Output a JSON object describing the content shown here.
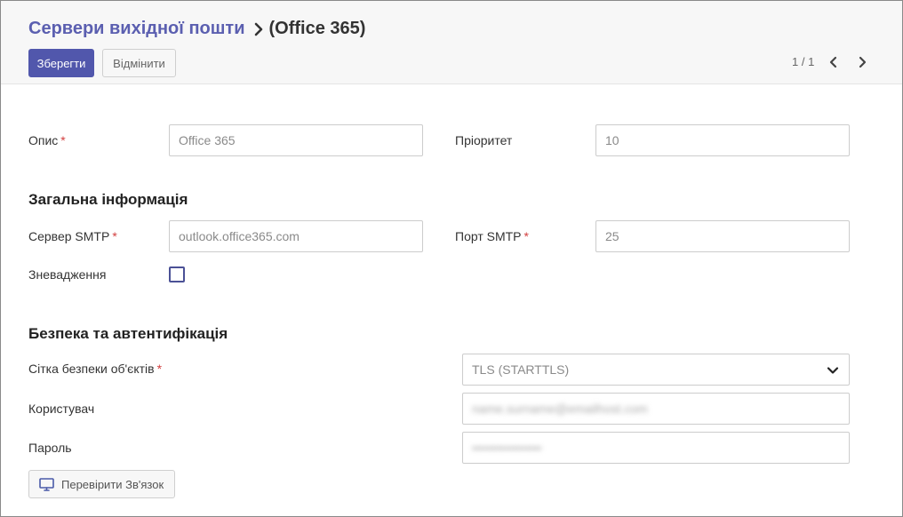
{
  "breadcrumb": {
    "parent": "Сервери вихідної пошти",
    "current": "(Office 365)"
  },
  "toolbar": {
    "save_label": "Зберегти",
    "discard_label": "Відмінити"
  },
  "pager": {
    "value": "1 / 1"
  },
  "form": {
    "description": {
      "label": "Опис",
      "required": "*",
      "value": "Office 365"
    },
    "priority": {
      "label": "Пріоритет",
      "value": "10"
    },
    "general_section": "Загальна інформація",
    "smtp_server": {
      "label": "Сервер SMTP",
      "required": "*",
      "value": "outlook.office365.com"
    },
    "smtp_port": {
      "label": "Порт SMTP",
      "required": "*",
      "value": "25"
    },
    "debug": {
      "label": "Зневадження",
      "checked": false
    },
    "security_section": "Безпека та автентифікація",
    "connection_security": {
      "label": "Сітка безпеки об'єктів",
      "required": "*",
      "value": "TLS (STARTTLS)"
    },
    "username": {
      "label": "Користувач",
      "value": "name.surname@emailhost.com"
    },
    "password": {
      "label": "Пароль",
      "value": "••••••••••••••••"
    },
    "test_button_label": "Перевірити Зв'язок"
  },
  "icons": {
    "breadcrumb_separator": "chevron-right-icon",
    "pager_prev": "chevron-left-icon",
    "pager_next": "chevron-right-icon",
    "select_arrow": "chevron-down-icon",
    "test_button": "monitor-icon"
  },
  "colors": {
    "primary": "#5157ac",
    "breadcrumb_link": "#5b5fb0",
    "required": "#d23f3f",
    "checkbox_border": "#4b5196"
  }
}
